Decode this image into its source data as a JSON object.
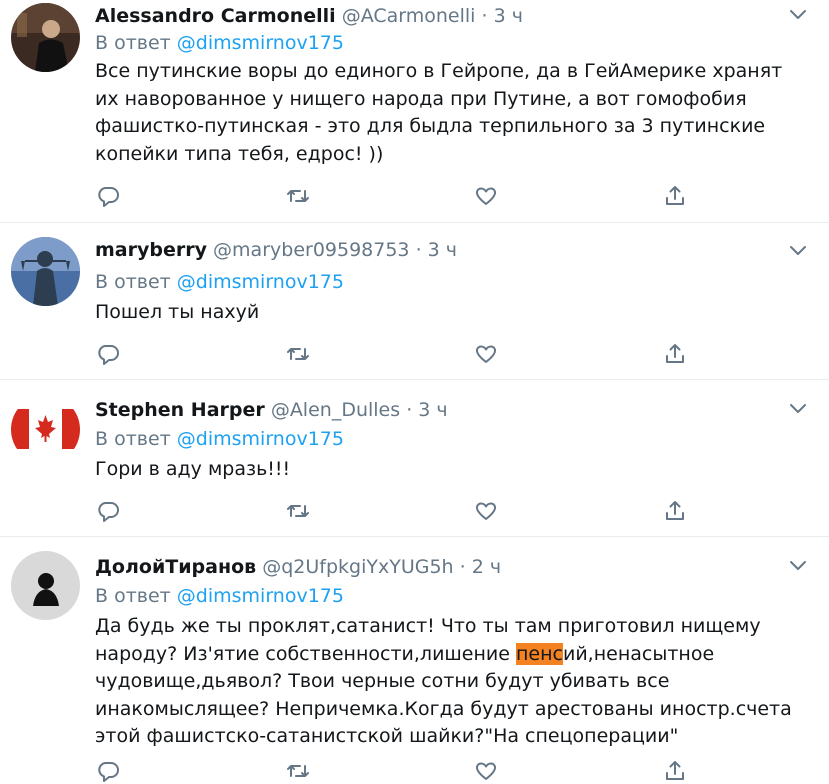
{
  "tweets": [
    {
      "name": "Alessandro Carmonelli",
      "handle": "@ACarmonelli",
      "dot": "·",
      "time": "3 ч",
      "reply_prefix": "В ответ",
      "reply_to": "@dimsmirnov175",
      "text": "Все путинские воры до единого в Гейропе, да в ГейАмерике хранят их наворованное у нищего народа при Путине, а вот гомофобия фашистко-путинская - это для быдла терпильного за 3 путинские копейки типа тебя, едрос! ))",
      "avatar_icon": "dark-photo-avatar"
    },
    {
      "name": "maryberry",
      "handle": "@maryber09598753",
      "dot": "·",
      "time": "3 ч",
      "reply_prefix": "В ответ",
      "reply_to": "@dimsmirnov175",
      "text": "Пошел ты нахуй",
      "avatar_icon": "justice-statue-avatar"
    },
    {
      "name": "Stephen Harper",
      "handle": "@Alen_Dulles",
      "dot": "·",
      "time": "3 ч",
      "reply_prefix": "В ответ",
      "reply_to": "@dimsmirnov175",
      "text": "Гори в аду мразь!!!",
      "avatar_icon": "canada-flag-avatar"
    },
    {
      "name": "ДолойТиранов",
      "handle": "@q2UfpkgiYxYUG5h",
      "dot": "·",
      "time": "2 ч",
      "reply_prefix": "В ответ",
      "reply_to": "@dimsmirnov175",
      "text_before": "Да будь же ты проклят,сатанист! Что ты там приготовил нищему народу? Из'ятие собственности,лишение ",
      "text_highlight": "пенс",
      "text_after": "ий,ненасытное чудовище,дьявол? Твои черные сотни будут убивать все инакомыслящее? Непричемка.Когда будут арестованы иностр.счета этой фашистско-сатанистской шайки?\"На спецоперации\"",
      "avatar_icon": "silhouette-avatar"
    }
  ],
  "action_icons": [
    "reply-icon",
    "retweet-icon",
    "like-icon",
    "share-icon"
  ],
  "colors": {
    "link": "#1da1f2",
    "secondary_text": "#657786",
    "icon": "#657786",
    "highlight": "#f58220",
    "divider": "#e6ecf0"
  }
}
